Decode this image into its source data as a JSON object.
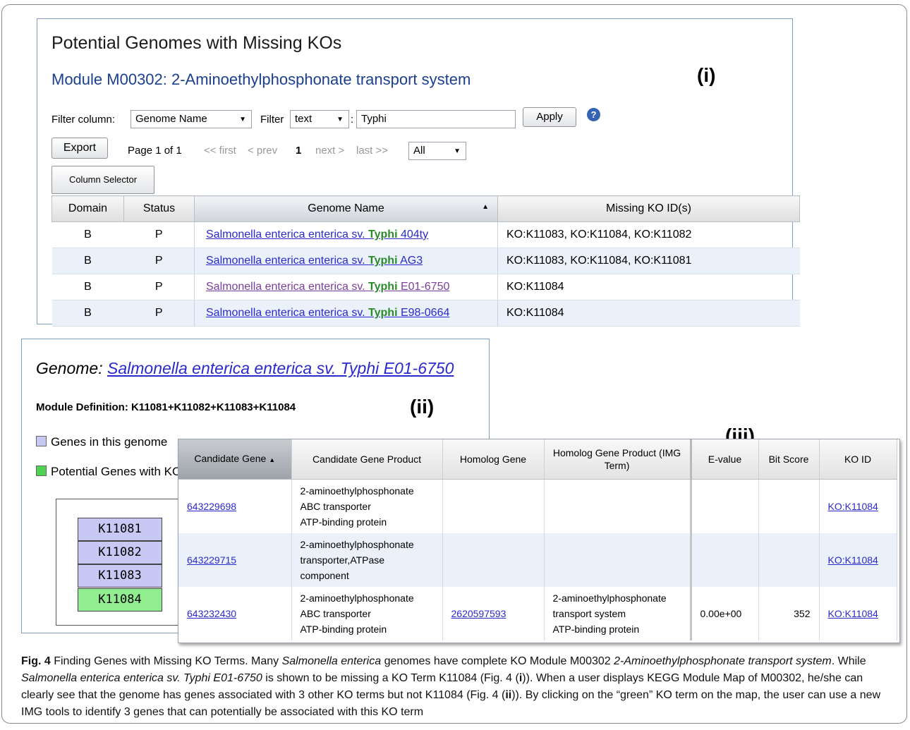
{
  "panel_i": {
    "title": "Potential Genomes with Missing KOs",
    "subtitle": "Module M00302: 2-Aminoethylphosphonate transport system",
    "tag": "(i)",
    "filter_column_label": "Filter column:",
    "filter_column_value": "Genome Name",
    "filter_label": "Filter",
    "filter_type_value": "text",
    "filter_colon": ":",
    "filter_text_value": "Typhi",
    "apply_label": "Apply",
    "help_glyph": "?",
    "export_label": "Export",
    "page_info": "Page 1 of 1",
    "first_label": "<< first",
    "prev_label": "< prev",
    "current_page": "1",
    "next_label": "next >",
    "last_label": "last >>",
    "rows_value": "All",
    "column_selector_label": "Column Selector",
    "columns": [
      "Domain",
      "Status",
      "Genome Name",
      "Missing KO ID(s)"
    ],
    "rows": [
      {
        "domain": "B",
        "status": "P",
        "genome_prefix": "Salmonella enterica enterica sv.",
        "genome_hl": "Typhi",
        "genome_suffix": "404ty",
        "ko": "KO:K11083, KO:K11084, KO:K11082"
      },
      {
        "domain": "B",
        "status": "P",
        "genome_prefix": "Salmonella enterica enterica sv.",
        "genome_hl": "Typhi",
        "genome_suffix": "AG3",
        "ko": "KO:K11083, KO:K11084, KO:K11081"
      },
      {
        "domain": "B",
        "status": "P",
        "genome_prefix": "Salmonella enterica enterica sv.",
        "genome_hl": "Typhi",
        "genome_suffix": "E01-6750",
        "ko": "KO:K11084"
      },
      {
        "domain": "B",
        "status": "P",
        "genome_prefix": "Salmonella enterica enterica sv.",
        "genome_hl": "Typhi",
        "genome_suffix": "E98-0664",
        "ko": "KO:K11084"
      }
    ]
  },
  "panel_ii": {
    "title_prefix": "Genome: ",
    "genome_link": "Salmonella enterica enterica sv. Typhi E01-6750",
    "module_definition": "Module Definition: K11081+K11082+K11083+K11084",
    "tag": "(ii)",
    "legend_genes": "Genes in this genome",
    "legend_potential": "Potential Genes with KO",
    "ko_blocks": [
      "K11081",
      "K11082",
      "K11083",
      "K11084"
    ]
  },
  "panel_iii": {
    "tag": "(iii)",
    "columns": [
      "Candidate Gene",
      "Candidate Gene Product",
      "Homolog Gene",
      "Homolog Gene Product (IMG Term)",
      "E-value",
      "Bit Score",
      "KO ID"
    ],
    "rows": [
      {
        "gene": "643229698",
        "product": [
          "2-aminoethylphosphonate",
          "ABC transporter",
          "ATP-binding protein"
        ],
        "homolog": "",
        "homolog_product": [
          "",
          "",
          ""
        ],
        "evalue": "",
        "bitscore": "",
        "ko": "KO:K11084"
      },
      {
        "gene": "643229715",
        "product": [
          "2-aminoethylphosphonate",
          "transporter,ATPase",
          "component"
        ],
        "homolog": "",
        "homolog_product": [
          "",
          "",
          ""
        ],
        "evalue": "",
        "bitscore": "",
        "ko": "KO:K11084"
      },
      {
        "gene": "643232430",
        "product": [
          "2-aminoethylphosphonate",
          "ABC transporter",
          "ATP-binding protein"
        ],
        "homolog": "2620597593",
        "homolog_product": [
          "2-aminoethylphosphonate",
          "transport system",
          "ATP-binding protein"
        ],
        "evalue": "0.00e+00",
        "bitscore": "352",
        "ko": "KO:K11084"
      }
    ]
  },
  "caption": {
    "fig_label": "Fig. 4",
    "t1": " Finding Genes with Missing KO Terms. Many ",
    "i1": "Salmonella enterica",
    "t2": " genomes have complete KO Module M00302 ",
    "i2": "2-Aminoethylphosphonate transport system",
    "t3": ". While ",
    "i3": "Salmonella enterica enterica sv. Typhi E01-6750",
    "t4": " is shown to be missing a KO Term K11084 (Fig. 4 (",
    "b1": "i",
    "t5": ")). When a user displays KEGG Module Map of M00302, he/she can clearly see that the genome has genes associated with 3 other KO terms but not K11084 (Fig. 4 (",
    "b2": "ii",
    "t6": ")). By clicking on the “green” KO term on the map, the user can use a new IMG tools to identify 3 genes that can potentially be associated with this KO term"
  },
  "colors": {
    "link": "#2a2acc",
    "visited_link": "#7a3e9a",
    "highlight_green": "#2a8a2a",
    "subtitle_blue": "#1b3f8f",
    "row_alt": "#eaf1fa",
    "ko_present": "#c8c8f4",
    "ko_missing": "#90ee90"
  }
}
